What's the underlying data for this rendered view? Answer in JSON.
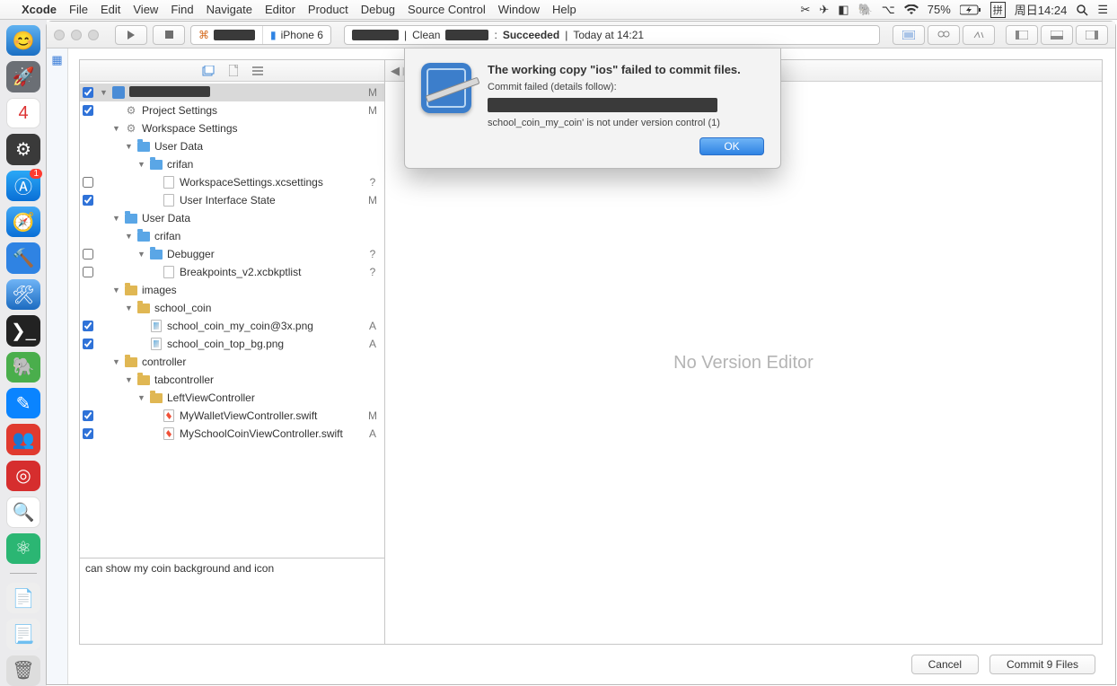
{
  "menubar": {
    "app": "Xcode",
    "items": [
      "File",
      "Edit",
      "View",
      "Find",
      "Navigate",
      "Editor",
      "Product",
      "Debug",
      "Source Control",
      "Window",
      "Help"
    ],
    "battery": "75%",
    "input": "拼",
    "clock": "周日14:24"
  },
  "toolbar": {
    "scheme_device": "iPhone 6",
    "status_mid": "Clean",
    "status_result": "Succeeded",
    "status_time": "Today at 14:21"
  },
  "tree": [
    {
      "depth": 0,
      "cb": "checked",
      "disc": "▼",
      "icon": "proj",
      "name": "",
      "status": "M",
      "sel": true,
      "mask": true
    },
    {
      "depth": 1,
      "cb": "checked",
      "disc": "",
      "icon": "gear",
      "name": "Project Settings",
      "status": "M"
    },
    {
      "depth": 1,
      "cb": "",
      "disc": "▼",
      "icon": "gear",
      "name": "Workspace Settings",
      "status": ""
    },
    {
      "depth": 2,
      "cb": "",
      "disc": "▼",
      "icon": "folder",
      "name": "User Data",
      "status": ""
    },
    {
      "depth": 3,
      "cb": "",
      "disc": "▼",
      "icon": "folder",
      "name": "crifan",
      "status": ""
    },
    {
      "depth": 4,
      "cb": "unchecked",
      "disc": "",
      "icon": "file",
      "name": "WorkspaceSettings.xcsettings",
      "status": "?"
    },
    {
      "depth": 4,
      "cb": "checked",
      "disc": "",
      "icon": "file",
      "name": "User Interface State",
      "status": "M"
    },
    {
      "depth": 1,
      "cb": "",
      "disc": "▼",
      "icon": "folder",
      "name": "User Data",
      "status": ""
    },
    {
      "depth": 2,
      "cb": "",
      "disc": "▼",
      "icon": "folder",
      "name": "crifan",
      "status": ""
    },
    {
      "depth": 3,
      "cb": "unchecked",
      "disc": "▼",
      "icon": "folder",
      "name": "Debugger",
      "status": "?"
    },
    {
      "depth": 4,
      "cb": "unchecked",
      "disc": "",
      "icon": "file",
      "name": "Breakpoints_v2.xcbkptlist",
      "status": "?"
    },
    {
      "depth": 1,
      "cb": "",
      "disc": "▼",
      "icon": "folderY",
      "name": "images",
      "status": ""
    },
    {
      "depth": 2,
      "cb": "",
      "disc": "▼",
      "icon": "folderY",
      "name": "school_coin",
      "status": ""
    },
    {
      "depth": 3,
      "cb": "checked",
      "disc": "",
      "icon": "img",
      "name": "school_coin_my_coin@3x.png",
      "status": "A"
    },
    {
      "depth": 3,
      "cb": "checked",
      "disc": "",
      "icon": "img",
      "name": "school_coin_top_bg.png",
      "status": "A"
    },
    {
      "depth": 1,
      "cb": "",
      "disc": "▼",
      "icon": "folderY",
      "name": "controller",
      "status": ""
    },
    {
      "depth": 2,
      "cb": "",
      "disc": "▼",
      "icon": "folderY",
      "name": "tabcontroller",
      "status": ""
    },
    {
      "depth": 3,
      "cb": "",
      "disc": "▼",
      "icon": "folderY",
      "name": "LeftViewController",
      "status": ""
    },
    {
      "depth": 4,
      "cb": "checked",
      "disc": "",
      "icon": "swift",
      "name": "MyWalletViewController.swift",
      "status": "M"
    },
    {
      "depth": 4,
      "cb": "checked",
      "disc": "",
      "icon": "swift",
      "name": "MySchoolCoinViewController.swift",
      "status": "A"
    }
  ],
  "commit_message": "can show my coin background and icon",
  "diff_placeholder": "No Version Editor",
  "dialog": {
    "title": "The working copy \"ios\" failed to commit files.",
    "sub": "Commit failed (details follow):",
    "detail": "school_coin_my_coin' is not under version control (1)",
    "ok": "OK"
  },
  "buttons": {
    "cancel": "Cancel",
    "commit": "Commit 9 Files"
  }
}
